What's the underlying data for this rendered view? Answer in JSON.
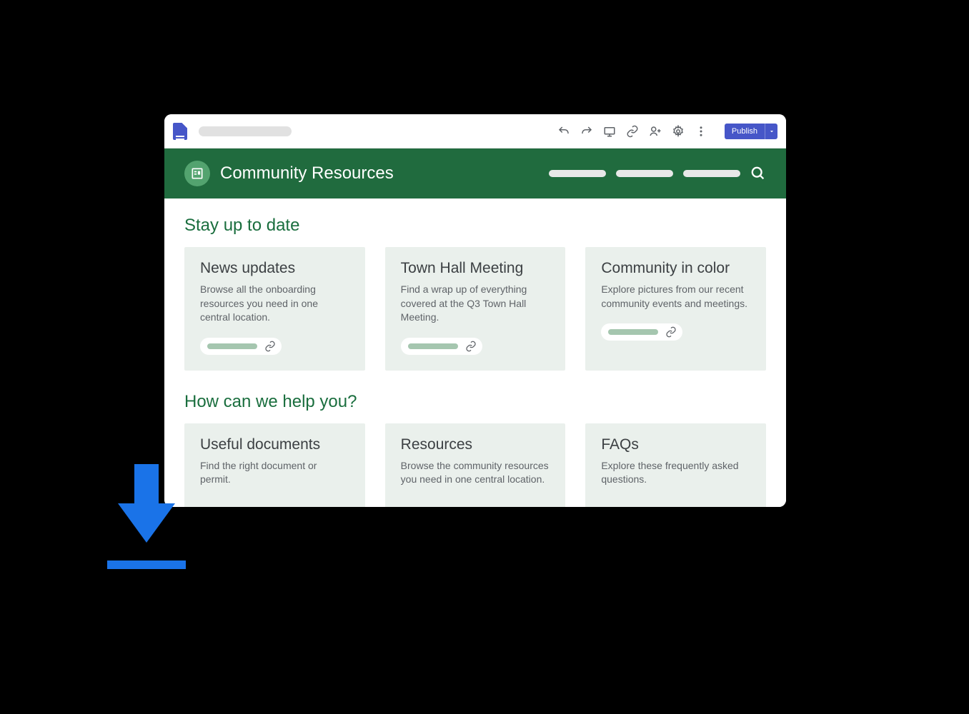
{
  "toolbar": {
    "publish_label": "Publish"
  },
  "page_header": {
    "title": "Community Resources"
  },
  "sections": [
    {
      "heading": "Stay up to date",
      "cards": [
        {
          "title": "News updates",
          "body": "Browse all the onboarding resources you need in one central location."
        },
        {
          "title": "Town Hall Meeting",
          "body": "Find a wrap up of everything covered at the Q3 Town Hall Meeting."
        },
        {
          "title": "Community in color",
          "body": "Explore pictures from our recent community events and meetings."
        }
      ]
    },
    {
      "heading": "How can we help you?",
      "cards": [
        {
          "title": "Useful documents",
          "body": "Find the right document or permit."
        },
        {
          "title": "Resources",
          "body": "Browse the community resources you need in one central location."
        },
        {
          "title": "FAQs",
          "body": "Explore these frequently asked questions."
        }
      ]
    }
  ]
}
